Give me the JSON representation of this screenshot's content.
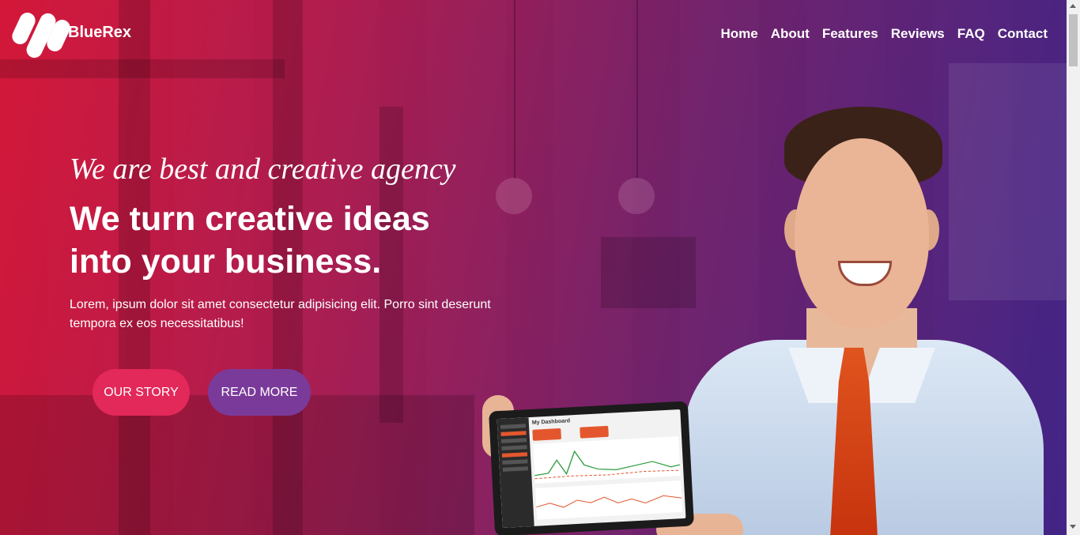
{
  "brand": {
    "name": "BlueRex"
  },
  "nav": {
    "items": [
      {
        "label": "Home"
      },
      {
        "label": "About"
      },
      {
        "label": "Features"
      },
      {
        "label": "Reviews"
      },
      {
        "label": "FAQ"
      },
      {
        "label": "Contact"
      }
    ]
  },
  "hero": {
    "tagline": "We are best and creative agency",
    "headline_line1": "We turn creative ideas",
    "headline_line2": "into your business.",
    "subtext": "Lorem, ipsum dolor sit amet consectetur adipisicing elit. Porro sint deserunt tempora ex eos necessitatibus!",
    "primary_button": "OUR STORY",
    "secondary_button": "READ MORE"
  },
  "tablet": {
    "screen_title": "My Dashboard"
  },
  "colors": {
    "gradient_start": "#e2183a",
    "gradient_end": "#462896",
    "primary_button": "#e3285a",
    "secondary_button": "#7a3a9a"
  }
}
